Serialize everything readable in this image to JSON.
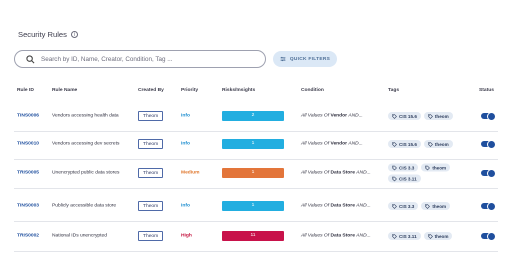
{
  "header": {
    "title": "Security Rules"
  },
  "search": {
    "placeholder": "Search by ID, Name, Creator, Condition, Tag ..."
  },
  "quick_filters": {
    "label": "QUICK FILTERS"
  },
  "columns": {
    "rule_id": "Rule ID",
    "rule_name": "Rule Name",
    "created_by": "Created By",
    "priority": "Priority",
    "risks": "Risks/Insights",
    "condition": "Condition",
    "tags": "Tags",
    "status": "Status"
  },
  "colors": {
    "info": "#1f8fd0",
    "medium": "#e0782e",
    "high": "#c4123d",
    "risk_info": "#22aee0",
    "risk_medium": "#e3753a",
    "risk_high": "#c8124a",
    "toggle_on": "#1f4f9e"
  },
  "rows": [
    {
      "id": "TINS0006",
      "name": "Vendors accessing health data",
      "creator": "Theom",
      "priority": "Info",
      "risks": "2",
      "cond_prefix": "All Values Of",
      "cond_field": "Vendor",
      "cond_suffix": "AND...",
      "tags": [
        "CIS 15.6",
        "theom"
      ],
      "status_on": true
    },
    {
      "id": "TINS0010",
      "name": "Vendors accessing dev secrets",
      "creator": "Theom",
      "priority": "Info",
      "risks": "1",
      "cond_prefix": "All Values Of",
      "cond_field": "Vendor",
      "cond_suffix": "AND...",
      "tags": [
        "CIS 15.6",
        "theom"
      ],
      "status_on": true
    },
    {
      "id": "TRIS0005",
      "name": "Unencrypted public data stores",
      "creator": "Theom",
      "priority": "Medium",
      "risks": "1",
      "cond_prefix": "All Values Of",
      "cond_field": "Data Store",
      "cond_suffix": "AND...",
      "tags": [
        "CIS 3.3",
        "theom",
        "CIS 3.11"
      ],
      "status_on": true
    },
    {
      "id": "TINS0003",
      "name": "Publicly accessible data store",
      "creator": "Theom",
      "priority": "Info",
      "risks": "1",
      "cond_prefix": "All Values Of",
      "cond_field": "Data Store",
      "cond_suffix": "AND...",
      "tags": [
        "CIS 3.3",
        "theom"
      ],
      "status_on": true
    },
    {
      "id": "TRIS0002",
      "name": "National IDs unencrypted",
      "creator": "Theom",
      "priority": "High",
      "risks": "11",
      "cond_prefix": "All Values Of",
      "cond_field": "Data Store",
      "cond_suffix": "AND...",
      "tags": [
        "CIS 3.11",
        "theom"
      ],
      "status_on": true
    }
  ]
}
